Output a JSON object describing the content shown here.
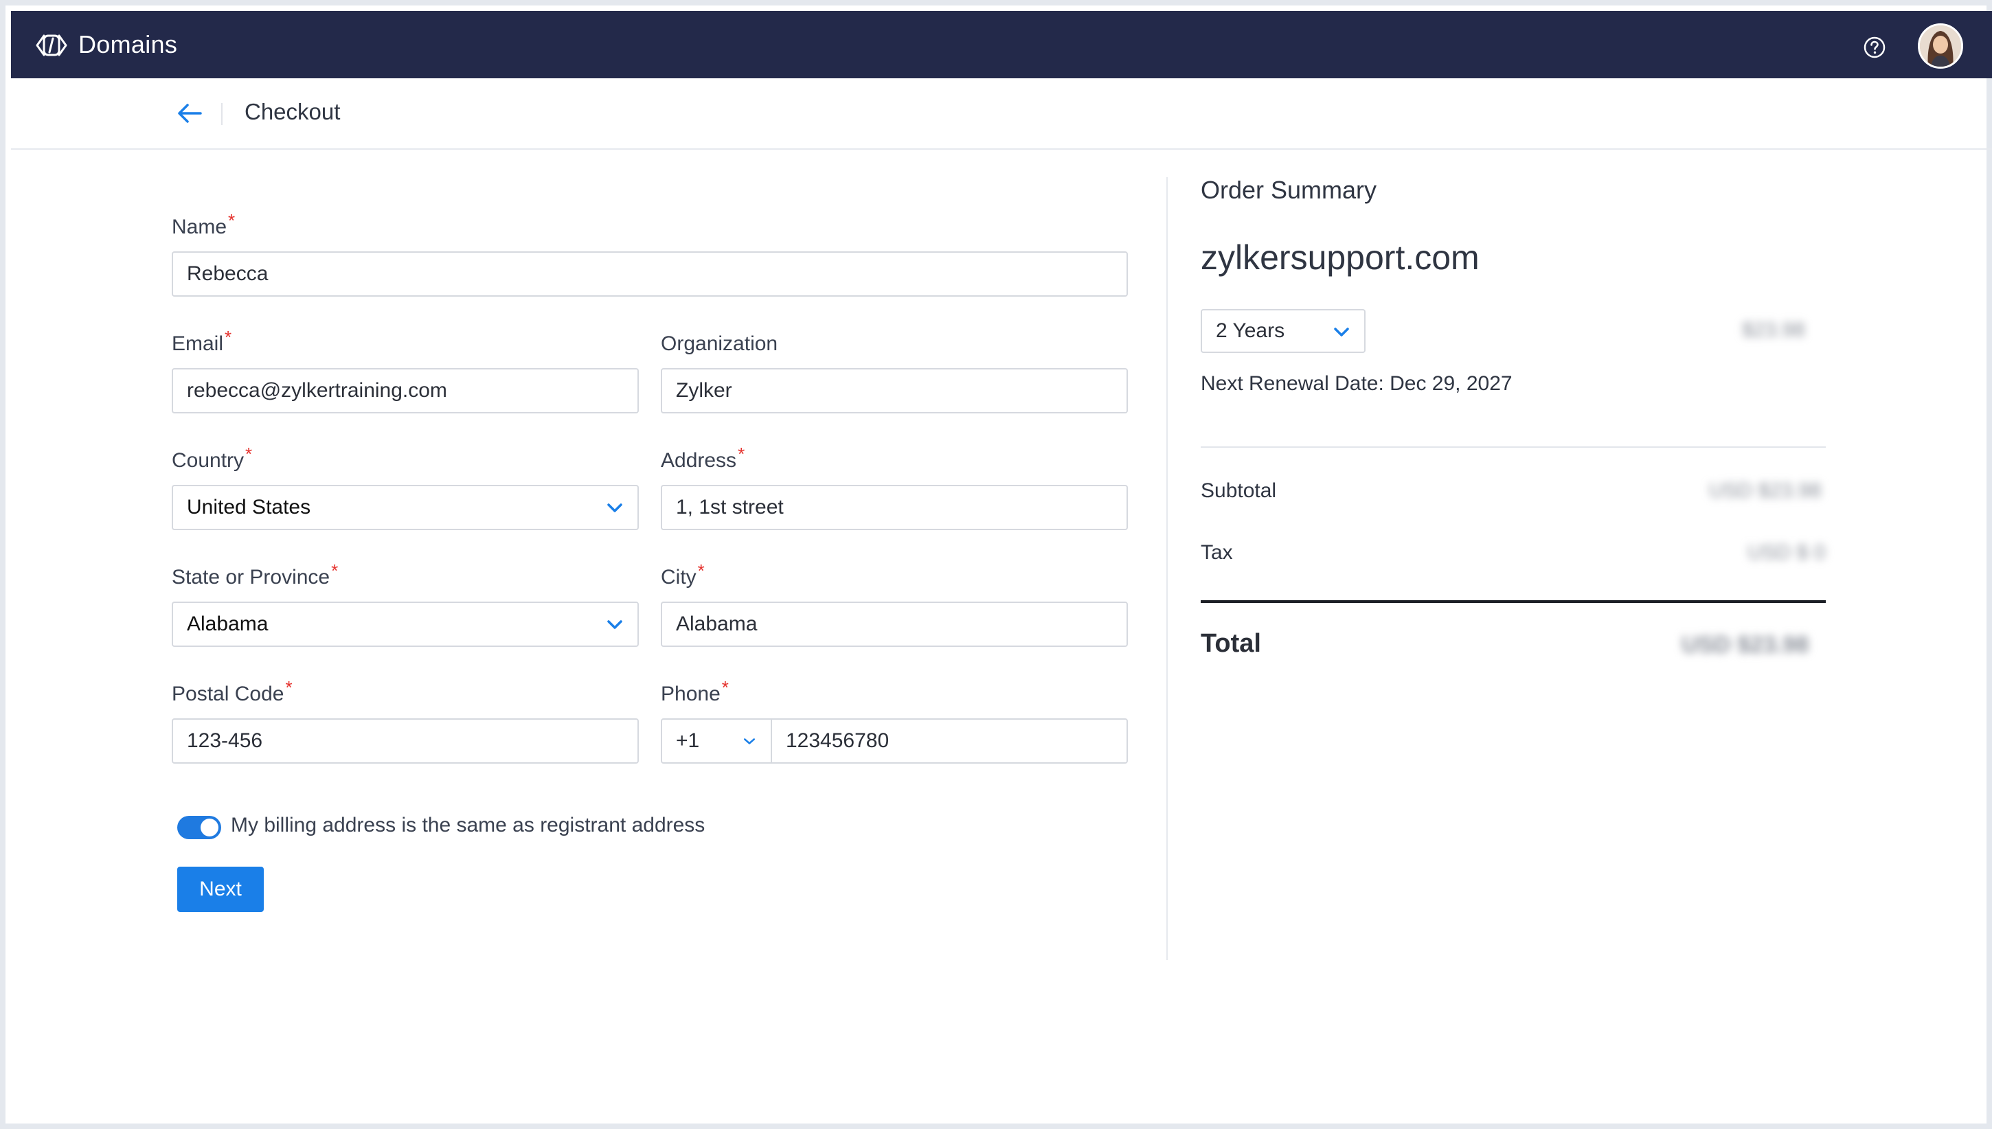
{
  "app": {
    "title": "Domains"
  },
  "header": {
    "page_title": "Checkout"
  },
  "form": {
    "name_label": "Name",
    "name_value": "Rebecca",
    "email_label": "Email",
    "email_value": "rebecca@zylkertraining.com",
    "organization_label": "Organization",
    "organization_value": "Zylker",
    "country_label": "Country",
    "country_value": "United States",
    "address_label": "Address",
    "address_value": "1, 1st street",
    "state_label": "State or Province",
    "state_value": "Alabama",
    "city_label": "City",
    "city_value": "Alabama",
    "postal_label": "Postal Code",
    "postal_value": "123-456",
    "phone_label": "Phone",
    "phone_code": "+1",
    "phone_value": "123456780",
    "required_mark": "*",
    "billing_toggle_label": "My billing address is the same as registrant address",
    "next_button": "Next"
  },
  "order_summary": {
    "title": "Order Summary",
    "domain": "zylkersupport.com",
    "term": "2 Years",
    "term_price": "$23.98",
    "next_renewal": "Next Renewal Date: Dec 29, 2027",
    "subtotal_label": "Subtotal",
    "subtotal_value": "USD $23.98",
    "tax_label": "Tax",
    "tax_value": "USD $ 0",
    "total_label": "Total",
    "total_value": "USD $23.98"
  },
  "colors": {
    "topbar": "#23294a",
    "accent": "#1a7fe8",
    "required": "#e5322d"
  },
  "icons": {
    "brand": "domains-logo-icon",
    "help": "help-circle-icon",
    "back": "arrow-left-icon",
    "dropdown": "chevron-down-icon"
  }
}
